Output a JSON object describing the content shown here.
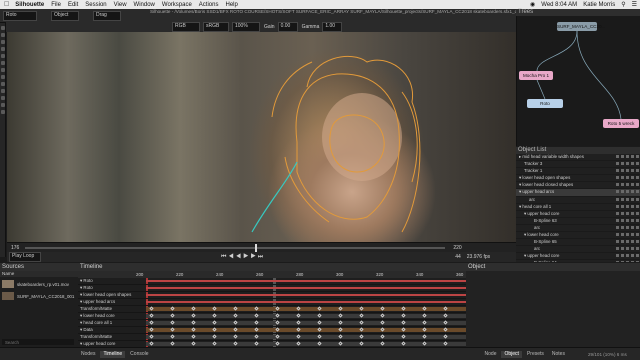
{
  "menubar": {
    "apple": "",
    "app_name": "Silhouette",
    "items": [
      "File",
      "Edit",
      "Session",
      "View",
      "Window",
      "Workspace",
      "Actions",
      "Help"
    ],
    "clock": "Wed 8:04 AM",
    "user": "Katie Morris"
  },
  "window_title": "Silhouette - /Volumes/Boris SSD1/BFX ROTO COURSE/SHOTS/SOFT SURFACE_ERIC_ARRAY SURF_MAYLA/Silhouette_projects/SURF_MAYLA_CC2018 skateboarders.sfx1_demo.s001*",
  "toolbar": {
    "tool_select": "Roto",
    "mode_select": "Object",
    "drag_select": "Drag",
    "view_select": "RGB",
    "zoom_select": "sRGB",
    "fit_select": "100%",
    "gain_label": "Gain",
    "gain_value": "0.00",
    "gamma_label": "Gamma",
    "gamma_value": "1.00"
  },
  "viewer": {
    "frame_left": "176",
    "frame_right": "220",
    "current_frame": "44",
    "fps": "23.976 fps",
    "play_mode": "Play Loop"
  },
  "trees": {
    "title": "Trees",
    "nodes": [
      "SURF_MAYLA_CC20...",
      "Mocha Pro 1",
      "Roto",
      "Roto 5 wreck"
    ]
  },
  "object_list": {
    "title": "Object List",
    "rows": [
      {
        "label": "▸ mid head variable width shapes",
        "indent": 0,
        "selected": false
      },
      {
        "label": "Tracker 3",
        "indent": 1,
        "selected": false
      },
      {
        "label": "Tracker 1",
        "indent": 1,
        "selected": false
      },
      {
        "label": "▾ lower head open shapes",
        "indent": 0,
        "selected": false
      },
      {
        "label": "▾ lower head closed shapes",
        "indent": 0,
        "selected": false
      },
      {
        "label": "▾ upper head arcs",
        "indent": 0,
        "selected": true
      },
      {
        "label": "arc",
        "indent": 2,
        "selected": false
      },
      {
        "label": "▾ head core all 1",
        "indent": 0,
        "selected": false
      },
      {
        "label": "▾ upper head core",
        "indent": 1,
        "selected": false
      },
      {
        "label": "B-Spline 63",
        "indent": 3,
        "selected": false
      },
      {
        "label": "arc",
        "indent": 3,
        "selected": false
      },
      {
        "label": "▾ lower head core",
        "indent": 1,
        "selected": false
      },
      {
        "label": "B-Spline 65",
        "indent": 3,
        "selected": false
      },
      {
        "label": "arc",
        "indent": 3,
        "selected": false
      },
      {
        "label": "▾ upper head core",
        "indent": 1,
        "selected": false
      },
      {
        "label": "B-Spline 64",
        "indent": 3,
        "selected": false
      },
      {
        "label": "▾ lower head core",
        "indent": 1,
        "selected": false
      },
      {
        "label": "B-Spline 66",
        "indent": 3,
        "selected": false
      }
    ],
    "footer_label": "Roto"
  },
  "sources": {
    "title": "Sources",
    "column": "Name",
    "items": [
      "skateboarders_rp.v01.mov",
      "SURF_MAYLA_CC2018_001"
    ],
    "search_placeholder": "Search"
  },
  "timeline": {
    "title": "Timeline",
    "ruler": [
      "200",
      "220",
      "240",
      "260",
      "280",
      "300",
      "320",
      "340",
      "360"
    ],
    "rows": [
      "▾ Roto",
      "▾ Roto",
      "▾ lower head open shapes",
      "▾ upper head arcs",
      "Transform/Matte",
      "▾ lower head core",
      "▾ head core all 1",
      "▾ Data",
      "Transform/Matte",
      "▾ upper head core",
      "▾ B-Spline 63"
    ]
  },
  "object_panel": {
    "title": "Object"
  },
  "bottom_tabs_left": [
    "Nodes",
    "Timeline",
    "Console"
  ],
  "bottom_tabs_right": [
    "Node",
    "Object",
    "Presets",
    "Notes"
  ],
  "status_right": "29/101 (10%)  6 ms"
}
